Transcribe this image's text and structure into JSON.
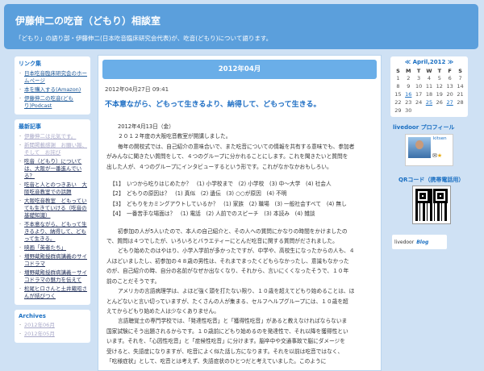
{
  "header": {
    "title": "伊藤伸二の吃音（どもり）相談室",
    "description": "「どもり」の語り部・伊藤伸二(日本吃音臨床研究会代表)が、吃音(どもり)について語ります。"
  },
  "sidebar_left": {
    "links": {
      "title": "リンク集",
      "items": [
        "日本吃音臨床研究会のホームページ",
        "本を購入する(Amazon)",
        "伊藤伸二の吃音(どもり)Podcast"
      ]
    },
    "recent": {
      "title": "最新記事",
      "items": [
        "伊藤伸二は元気です。",
        "新聞掲載感謝　お願い報、そして　お詫び",
        "吃音（どもり）については、大阪が一番進んでいる？",
        "吃音と人とのつきあい　大阪吃音教室での話題",
        "大阪吃音教室　どもっていても生きていける（吃音の基礎知識）",
        "不本意ながら、どもって生きるより、納得して、どもって生きる。",
        "映画「英者たち」",
        "増野蔵殿授群病講義のサイコドラマ",
        "増野蔵殿授群病講義－サイコドラマの魅力を伝えて",
        "松尾ヒロさんと土井蔵昭さんが結びつく"
      ]
    },
    "archives": {
      "title": "Archives",
      "items": [
        "2012年06月",
        "2012年05月"
      ]
    }
  },
  "main": {
    "month_label": "2012年04月",
    "post": {
      "datetime": "2012年04月27日 09:41",
      "title": "不本意ながら、どもって生きるより、納得して、どもって生きる。",
      "paragraphs": [
        "2012年4月13日（金）",
        "２０１２年度の大阪吃音教室が開講しました。",
        "毎年の開校式では、自己紹介の意味合いで、また吃音についての情報を共有する意味でも、参加者",
        "がみんなに聞きたい質問をして、４つのグループに分かれることにします。これを聞きたいと質問を",
        "出した人が、４つのグループにインタビューするという形です。これがなかなかおもしろい。",
        "【1】　いつから吃りはじめたか？　(1) 小学校まで　(2) 小学校　(3) 中～大学　(4) 社会人",
        "【2】　どもりの原因は？　(1) 真似　(2) 遺伝　(3) ○○が原因　(4) 不明",
        "【3】　どもりをカミングアウトしているか？　(1) 家族　(2) 職場　(3) 一般社会すべて　(4) 無し",
        "【4】　一番苦手な場面は？　(1) 電話　(2) 人前でのスピーチ　(3) 本読み　(4) 雑談",
        "初参加の人が5人いたので、本人の自己紹介と、その人への質問にかなりの時間をかけましたの",
        "で、質問は４つでしたが、いろいろとバラエティーにとんだ吃音に関する質問がだされました。",
        "どもり始めたのはやはり、小学入学前が多かったですが、中学や、高校生になったからの人も、４",
        "人ほどいましたし、初参加の４８歳の男性は、それまでまったくどもらなかったし、意識もなかった",
        "のが、自己紹介の時、自分の名前がなぜか出なくなり、それから、言いにくくなったそうで、１０年",
        "前のことだそうです。",
        "アメリカの言語病理学は、よほど強く頭を打たない限り、１０歳を超えてどもり始めることは、ほ",
        "とんどないと言い切っていますが、たくさんの人が集まる、セルフヘルプグループには、１０歳を超",
        "えてからどもり始めた人は少なくありません。",
        "言語聴覚士の専門学校では、「発達性吃音」と「獲得性吃音」があると教えなければならないま",
        "国家試験にそう出題されるからです。１０歳前にどもり始めるのを発達性で、それ以降を獲得性とい",
        "います。それを、「心因性吃音」と「症候性吃音」に分けます。脳卒中や交通事故で脳にダメージを",
        "受けると、失語症になりますが、吃音によく似た話し方になります。それを以前は吃音ではなく、",
        "「吃様症状」として、吃音とは考えず、失語症状のひとつだと考えていました。このように"
      ]
    }
  },
  "sidebar_right": {
    "calendar": {
      "prev": "≪",
      "title": "April,2012",
      "next": "≫",
      "weekdays": [
        "S",
        "M",
        "T",
        "W",
        "T",
        "F",
        "S"
      ],
      "weeks": [
        [
          "1",
          "2",
          "3",
          "4",
          "5",
          "6",
          "7"
        ],
        [
          "8",
          "9",
          "10",
          "11",
          "12",
          "13",
          "14"
        ],
        [
          "15",
          "16",
          "17",
          "18",
          "19",
          "20",
          "21"
        ],
        [
          "22",
          "23",
          "24",
          "25",
          "26",
          "27",
          "28"
        ],
        [
          "29",
          "30",
          "",
          "",
          "",
          "",
          ""
        ]
      ],
      "linked_days": [
        "16",
        "25",
        "27"
      ]
    },
    "profile_title": "livedoor プロフィール",
    "profile_name": "kitsen",
    "qr_title": "QRコード（携帯電話用）",
    "livedoor_label": "livedoor",
    "livedoor_blog_label": "Blog"
  },
  "colors": {
    "header": "#5b9fdc",
    "background": "#cfe1f4",
    "accent": "#1a6fc2"
  }
}
